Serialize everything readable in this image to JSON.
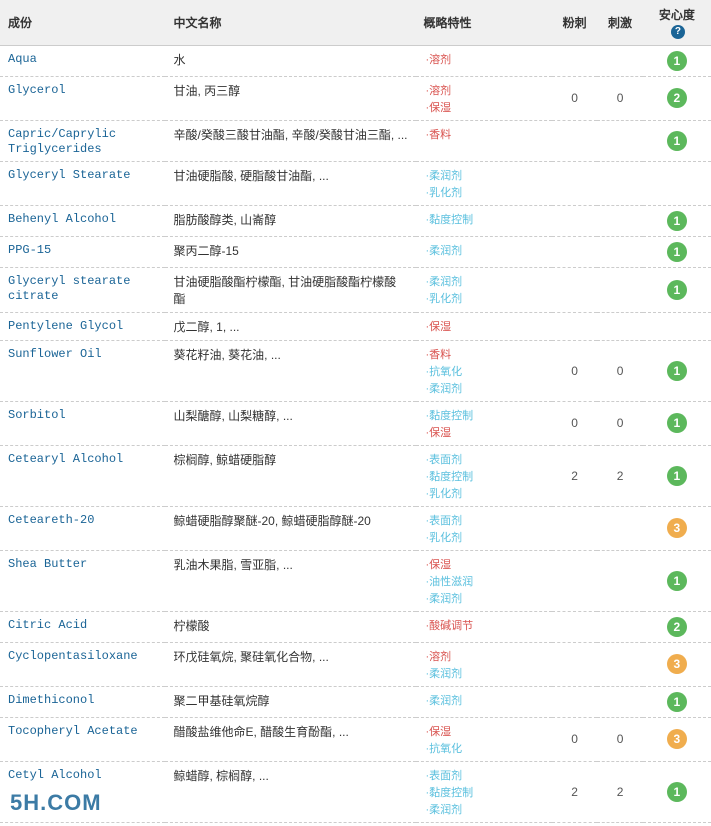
{
  "header": {
    "col1": "成份",
    "col2": "中文名称",
    "col3": "概略特性",
    "col4": "粉刺",
    "col5": "刺激",
    "col6": "安心度"
  },
  "rows": [
    {
      "name": "Aqua",
      "chinese": "水",
      "tags": [
        {
          "label": "·溶剂",
          "type": "solvent"
        }
      ],
      "acne": "",
      "irritant": "",
      "safety": "1",
      "safety_color": "green"
    },
    {
      "name": "Glycerol",
      "chinese": "甘油, 丙三醇",
      "tags": [
        {
          "label": "·溶剂",
          "type": "solvent"
        },
        {
          "label": "·保湿",
          "type": "humectant"
        }
      ],
      "acne": "0",
      "irritant": "0",
      "safety": "2",
      "safety_color": "green"
    },
    {
      "name": "Capric/Caprylic\nTriglycerides",
      "chinese": "辛酸/癸酸三酸甘油酯, 辛酸/癸酸甘油三酯, ...",
      "tags": [
        {
          "label": "·香料",
          "type": "fragrance"
        }
      ],
      "acne": "",
      "irritant": "",
      "safety": "1",
      "safety_color": "green"
    },
    {
      "name": "Glyceryl Stearate",
      "chinese": "甘油硬脂酸, 硬脂酸甘油酯, ...",
      "tags": [
        {
          "label": "·柔润剂",
          "type": "emollient"
        },
        {
          "label": "·乳化剂",
          "type": "emulsifier"
        }
      ],
      "acne": "",
      "irritant": "",
      "safety": "",
      "safety_color": ""
    },
    {
      "name": "Behenyl Alcohol",
      "chinese": "脂肪酸醇类, 山崙醇",
      "tags": [
        {
          "label": "·黏度控制",
          "type": "viscosity"
        }
      ],
      "acne": "",
      "irritant": "",
      "safety": "1",
      "safety_color": "green"
    },
    {
      "name": "PPG-15",
      "chinese": "聚丙二醇-15",
      "tags": [
        {
          "label": "·柔润剂",
          "type": "emollient"
        }
      ],
      "acne": "",
      "irritant": "",
      "safety": "1",
      "safety_color": "green"
    },
    {
      "name": "Glyceryl stearate citrate",
      "chinese": "甘油硬脂酸酯柠檬酯, 甘油硬脂酸酯柠檬酸酯",
      "tags": [
        {
          "label": "·柔润剂",
          "type": "emollient"
        },
        {
          "label": "·乳化剂",
          "type": "emulsifier"
        }
      ],
      "acne": "",
      "irritant": "",
      "safety": "1",
      "safety_color": "green"
    },
    {
      "name": "Pentylene Glycol",
      "chinese": "戊二醇, 1, ...",
      "tags": [
        {
          "label": "·保湿",
          "type": "humectant"
        }
      ],
      "acne": "",
      "irritant": "",
      "safety": "",
      "safety_color": ""
    },
    {
      "name": "Sunflower Oil",
      "chinese": "葵花籽油, 葵花油, ...",
      "tags": [
        {
          "label": "·香料",
          "type": "fragrance"
        },
        {
          "label": "·抗氧化",
          "type": "antioxidant"
        },
        {
          "label": "·柔润剂",
          "type": "emollient"
        }
      ],
      "acne": "0",
      "irritant": "0",
      "safety": "1",
      "safety_color": "green"
    },
    {
      "name": "Sorbitol",
      "chinese": "山梨醣醇, 山梨糖醇, ...",
      "tags": [
        {
          "label": "·黏度控制",
          "type": "viscosity"
        },
        {
          "label": "·保湿",
          "type": "humectant"
        }
      ],
      "acne": "0",
      "irritant": "0",
      "safety": "1",
      "safety_color": "green"
    },
    {
      "name": "Cetearyl Alcohol",
      "chinese": "棕榈醇, 鲸蜡硬脂醇",
      "tags": [
        {
          "label": "·表面剂",
          "type": "surfactant"
        },
        {
          "label": "·黏度控制",
          "type": "viscosity"
        },
        {
          "label": "·乳化剂",
          "type": "emulsifier"
        }
      ],
      "acne": "2",
      "irritant": "2",
      "safety": "1",
      "safety_color": "green"
    },
    {
      "name": "Ceteareth-20",
      "chinese": "鲸蜡硬脂醇聚醚-20, 鲸蜡硬脂醇醚-20",
      "tags": [
        {
          "label": "·表面剂",
          "type": "surfactant"
        },
        {
          "label": "·乳化剂",
          "type": "emulsifier"
        }
      ],
      "acne": "",
      "irritant": "",
      "safety": "3",
      "safety_color": "orange"
    },
    {
      "name": "Shea Butter",
      "chinese": "乳油木果脂, 雪亚脂, ...",
      "tags": [
        {
          "label": "·保湿",
          "type": "humectant"
        },
        {
          "label": "·油性滋润",
          "type": "oily"
        },
        {
          "label": "·柔润剂",
          "type": "emollient"
        }
      ],
      "acne": "",
      "irritant": "",
      "safety": "1",
      "safety_color": "green"
    },
    {
      "name": "Citric Acid",
      "chinese": "柠檬酸",
      "tags": [
        {
          "label": "·酸碱调节",
          "type": "acid"
        }
      ],
      "acne": "",
      "irritant": "",
      "safety": "2",
      "safety_color": "green"
    },
    {
      "name": "Cyclopentasiloxane",
      "chinese": "环戊硅氧烷, 聚硅氧化合物, ...",
      "tags": [
        {
          "label": "·溶剂",
          "type": "solvent"
        },
        {
          "label": "·柔润剂",
          "type": "emollient"
        }
      ],
      "acne": "",
      "irritant": "",
      "safety": "3",
      "safety_color": "orange"
    },
    {
      "name": "Dimethiconol",
      "chinese": "聚二甲基硅氧烷醇",
      "tags": [
        {
          "label": "·柔润剂",
          "type": "emollient"
        }
      ],
      "acne": "",
      "irritant": "",
      "safety": "1",
      "safety_color": "green"
    },
    {
      "name": "Tocopheryl Acetate",
      "chinese": "醋酸盐维他命E, 醋酸生育酚酯, ...",
      "tags": [
        {
          "label": "·保湿",
          "type": "humectant"
        },
        {
          "label": "·抗氧化",
          "type": "antioxidant"
        }
      ],
      "acne": "0",
      "irritant": "0",
      "safety": "3",
      "safety_color": "orange"
    },
    {
      "name": "Cetyl Alcohol",
      "chinese": "鲸蜡醇, 棕榈醇, ...",
      "tags": [
        {
          "label": "·表面剂",
          "type": "surfactant"
        },
        {
          "label": "·黏度控制",
          "type": "viscosity"
        },
        {
          "label": "·柔润剂",
          "type": "emollient"
        }
      ],
      "acne": "2",
      "irritant": "2",
      "safety": "1",
      "safety_color": "green"
    }
  ],
  "watermark": "5H.COM"
}
